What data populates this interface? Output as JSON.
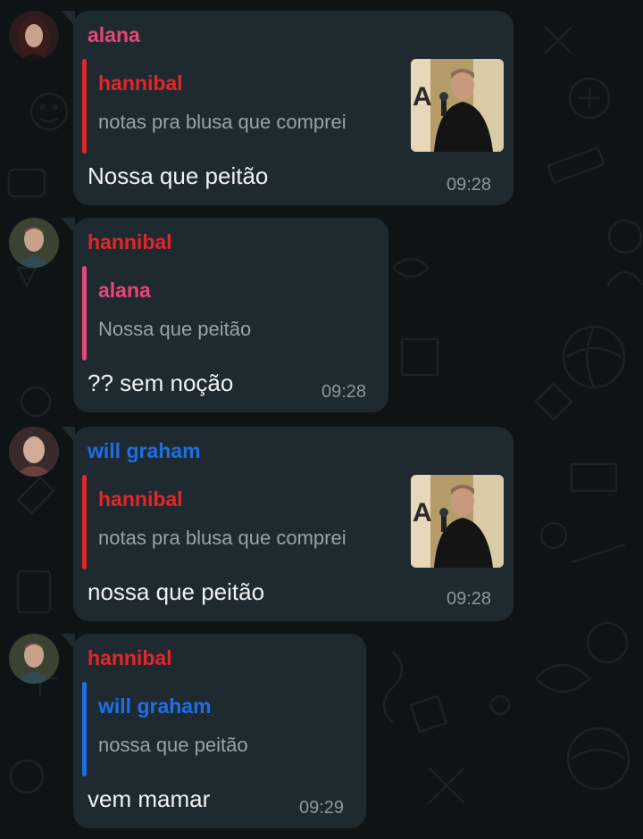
{
  "colors": {
    "background": "#0e1316",
    "bubble": "#1e2a30",
    "alana": "#e8457a",
    "hannibal": "#e2262a",
    "will_graham": "#1e6fe6",
    "reply_text": "#98a3a8",
    "message_text": "#f0f2f3",
    "time": "#8c979c"
  },
  "messages": [
    {
      "sender": "alana",
      "reply": {
        "name": "hannibal",
        "text": "notas pra blusa que comprei",
        "has_thumbnail": true
      },
      "text": "Nossa que peitão",
      "time": "09:28"
    },
    {
      "sender": "hannibal",
      "reply": {
        "name": "alana",
        "text": "Nossa que peitão",
        "has_thumbnail": false
      },
      "text": "?? sem noção",
      "time": "09:28"
    },
    {
      "sender": "will graham",
      "reply": {
        "name": "hannibal",
        "text": "notas pra blusa que comprei",
        "has_thumbnail": true
      },
      "text": "nossa que peitão",
      "time": "09:28"
    },
    {
      "sender": "hannibal",
      "reply": {
        "name": "will graham",
        "text": "nossa que peitão",
        "has_thumbnail": false
      },
      "text": "vem mamar",
      "time": "09:29"
    }
  ]
}
